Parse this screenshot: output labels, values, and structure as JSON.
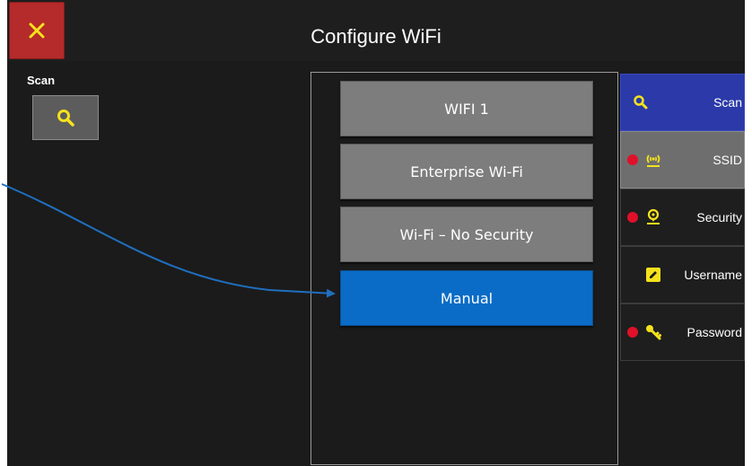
{
  "header": {
    "title": "Configure WiFi",
    "close_icon": "close-icon"
  },
  "left": {
    "scan_label": "Scan",
    "scan_icon": "search-icon"
  },
  "networks": {
    "items": [
      "WIFI 1",
      "Enterprise Wi-Fi",
      "Wi-Fi – No Security",
      "Manual"
    ],
    "selected": "Manual"
  },
  "sidebar": {
    "items": [
      {
        "label": "Scan",
        "icon": "search-icon",
        "state": "active",
        "required": false
      },
      {
        "label": "SSID",
        "icon": "wifi-antenna-icon",
        "state": "gray",
        "required": true
      },
      {
        "label": "Security",
        "icon": "security-pin-icon",
        "state": "normal",
        "required": true
      },
      {
        "label": "Username",
        "icon": "pencil-icon",
        "state": "normal",
        "required": false
      },
      {
        "label": "Password",
        "icon": "key-icon",
        "state": "normal",
        "required": true
      }
    ]
  },
  "colors": {
    "background": "#1b1b1b",
    "close": "#b52a2a",
    "accent_icon": "#f5e21c",
    "selected": "#0a6cc7",
    "active_side": "#2b3aa8",
    "required_dot": "#e0102a",
    "annotation_arrow": "#1f6fc0"
  }
}
